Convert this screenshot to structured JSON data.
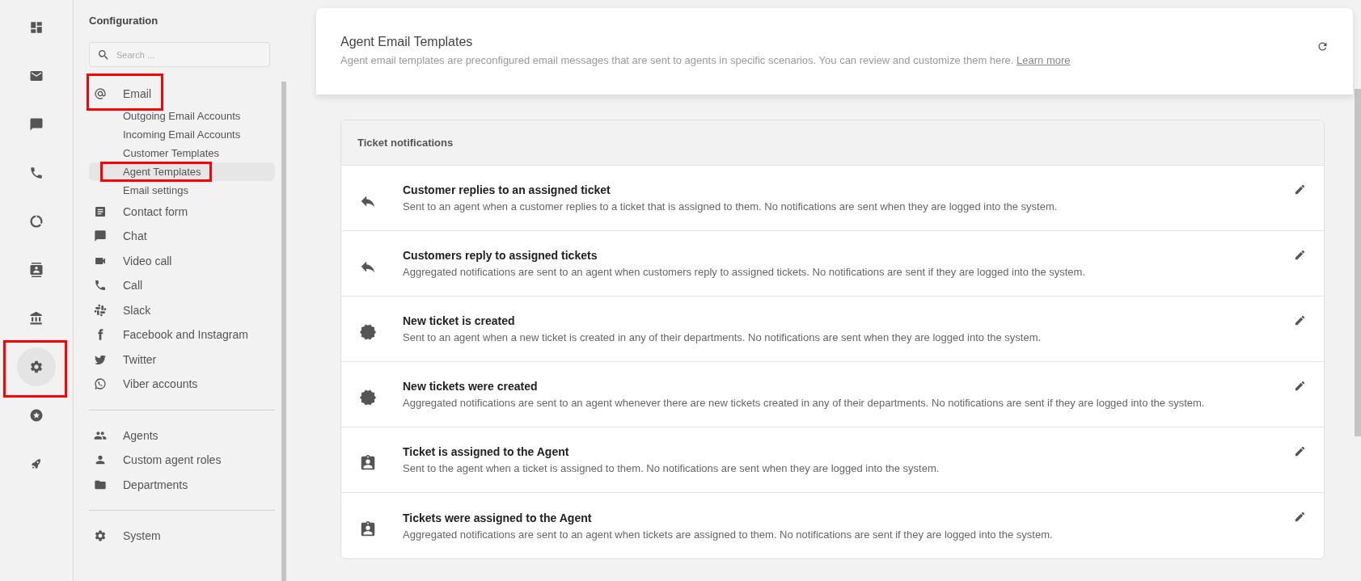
{
  "rail": [
    {
      "kind": "dashboard",
      "selected": false,
      "annotated": false
    },
    {
      "kind": "mail",
      "selected": false,
      "annotated": false
    },
    {
      "kind": "chat",
      "selected": false,
      "annotated": false
    },
    {
      "kind": "phone",
      "selected": false,
      "annotated": false
    },
    {
      "kind": "donut",
      "selected": false,
      "annotated": false
    },
    {
      "kind": "contact",
      "selected": false,
      "annotated": false
    },
    {
      "kind": "bank",
      "selected": false,
      "annotated": false
    },
    {
      "kind": "gear",
      "selected": true,
      "annotated": true
    },
    {
      "kind": "star",
      "selected": false,
      "annotated": false
    },
    {
      "kind": "rocket",
      "selected": false,
      "annotated": false
    }
  ],
  "sidebar": {
    "title": "Configuration",
    "search": {
      "placeholder": "Search ..."
    },
    "sections": [
      {
        "items": [
          {
            "kind": "at",
            "label": "Email",
            "selected": false,
            "annotated": true,
            "children": [
              {
                "label": "Outgoing Email Accounts",
                "selected": false,
                "annotated": false
              },
              {
                "label": "Incoming Email Accounts",
                "selected": false,
                "annotated": false
              },
              {
                "label": "Customer Templates",
                "selected": false,
                "annotated": false
              },
              {
                "label": "Agent Templates",
                "selected": true,
                "annotated": true
              },
              {
                "label": "Email settings",
                "selected": false,
                "annotated": false
              }
            ]
          },
          {
            "kind": "form",
            "label": "Contact form",
            "selected": false,
            "annotated": false
          },
          {
            "kind": "chat",
            "label": "Chat",
            "selected": false,
            "annotated": false
          },
          {
            "kind": "video",
            "label": "Video call",
            "selected": false,
            "annotated": false
          },
          {
            "kind": "phone",
            "label": "Call",
            "selected": false,
            "annotated": false
          },
          {
            "kind": "slack",
            "label": "Slack",
            "selected": false,
            "annotated": false
          },
          {
            "kind": "facebook",
            "label": "Facebook and Instagram",
            "selected": false,
            "annotated": false
          },
          {
            "kind": "twitter",
            "label": "Twitter",
            "selected": false,
            "annotated": false
          },
          {
            "kind": "viber",
            "label": "Viber accounts",
            "selected": false,
            "annotated": false
          }
        ]
      },
      {
        "items": [
          {
            "kind": "agents",
            "label": "Agents",
            "selected": false,
            "annotated": false
          },
          {
            "kind": "person",
            "label": "Custom agent roles",
            "selected": false,
            "annotated": false
          },
          {
            "kind": "folder",
            "label": "Departments",
            "selected": false,
            "annotated": false
          }
        ]
      },
      {
        "items": [
          {
            "kind": "gear",
            "label": "System",
            "selected": false,
            "annotated": false
          }
        ]
      }
    ]
  },
  "header": {
    "title": "Agent Email Templates",
    "description": "Agent email templates are preconfigured email messages that are sent to agents in specific scenarios. You can review and customize them here.",
    "link": "Learn more"
  },
  "section": {
    "title": "Ticket notifications",
    "rows": [
      {
        "kind": "reply",
        "title": "Customer replies to an assigned ticket",
        "description": "Sent to an agent when a customer replies to a ticket that is assigned to them. No notifications are sent when they are logged into the system."
      },
      {
        "kind": "reply",
        "title": "Customers reply to assigned tickets",
        "description": "Aggregated notifications are sent to an agent when customers reply to assigned tickets. No notifications are sent if they are logged into the system."
      },
      {
        "kind": "new",
        "title": "New ticket is created",
        "description": "Sent to an agent when a new ticket is created in any of their departments. No notifications are sent when they are logged into the system."
      },
      {
        "kind": "new",
        "title": "New tickets were created",
        "description": "Aggregated notifications are sent to an agent whenever there are new tickets created in any of their departments. No notifications are sent if they are logged into the system."
      },
      {
        "kind": "assigned",
        "title": "Ticket is assigned to the Agent",
        "description": "Sent to the agent when a ticket is assigned to them. No notifications are sent when they are logged into the system."
      },
      {
        "kind": "assigned",
        "title": "Tickets were assigned to the Agent",
        "description": "Aggregated notifications are sent to an agent when tickets are assigned to them. No notifications are sent if they are logged into the system."
      }
    ]
  }
}
